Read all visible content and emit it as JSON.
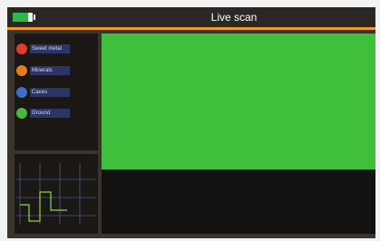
{
  "window": {
    "title": "Live scan"
  },
  "battery": {
    "level": 0.75,
    "color": "#2fb84a"
  },
  "accent_color": "#f09a1e",
  "legend": [
    {
      "label": "Sweet metal",
      "color": "#e23a2f"
    },
    {
      "label": "Minerals",
      "color": "#e57b23"
    },
    {
      "label": "Caves",
      "color": "#3f6cc8"
    },
    {
      "label": "Ground",
      "color": "#49b83a"
    }
  ],
  "scan_screen": {
    "color": "#40bf3d",
    "fill_level": 0.68
  },
  "signal_graph": {
    "line_color": "#8fd64a",
    "grid_color": "#4d5a86"
  }
}
